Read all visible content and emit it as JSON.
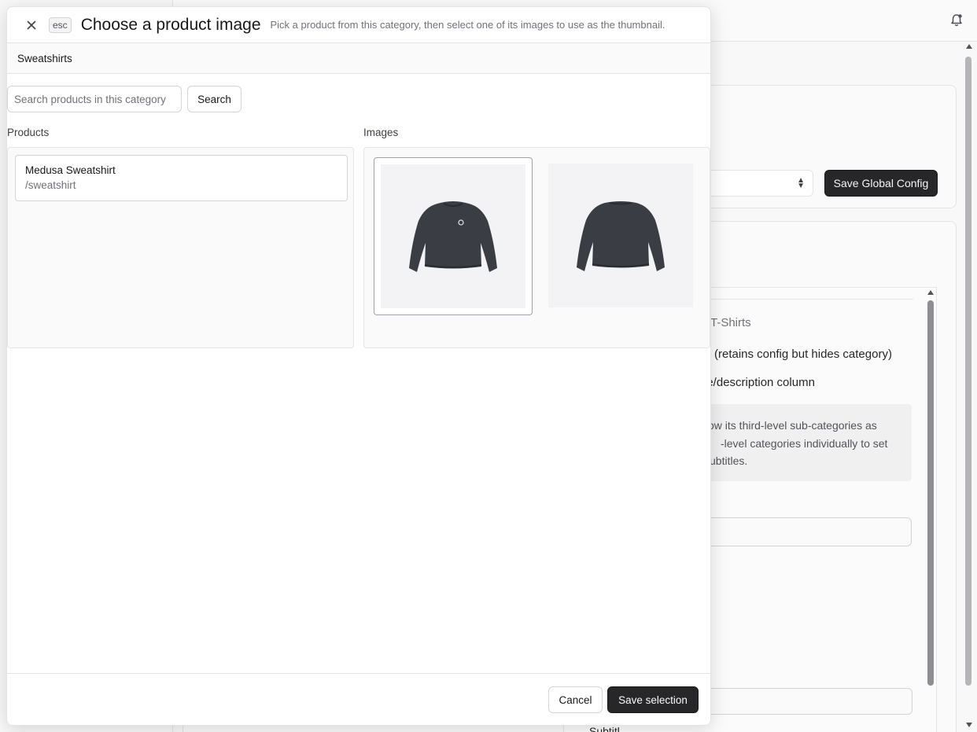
{
  "background": {
    "save_global_label": "Save Global Config",
    "category_name_fragment": "T-Shirts",
    "hide_option_fragment": "(retains config but hides category)",
    "column_option_fragment": "ge/description column",
    "note_lines": [
      "ow its third-level sub-categories as",
      "-level categories individually to set",
      "l subtitles."
    ],
    "subtitle_label_fragment": "Subtitl"
  },
  "modal": {
    "title": "Choose a product image",
    "subtitle": "Pick a product from this category, then select one of its images to use as the thumbnail.",
    "esc_label": "esc",
    "category": "Sweatshirts",
    "search": {
      "placeholder": "Search products in this category",
      "value": "",
      "button_label": "Search"
    },
    "products_label": "Products",
    "images_label": "Images",
    "products": [
      {
        "name": "Medusa Sweatshirt",
        "handle": "/sweatshirt"
      }
    ],
    "images": [
      {
        "alt": "sweatshirt-front",
        "selected": true
      },
      {
        "alt": "sweatshirt-back",
        "selected": false
      }
    ],
    "footer": {
      "cancel_label": "Cancel",
      "save_label": "Save selection"
    }
  },
  "colors": {
    "primary_button": "#27272a",
    "sweatshirt": "#3a3d44"
  },
  "icons": [
    "close-icon",
    "bell-icon",
    "select-arrows-icon"
  ]
}
